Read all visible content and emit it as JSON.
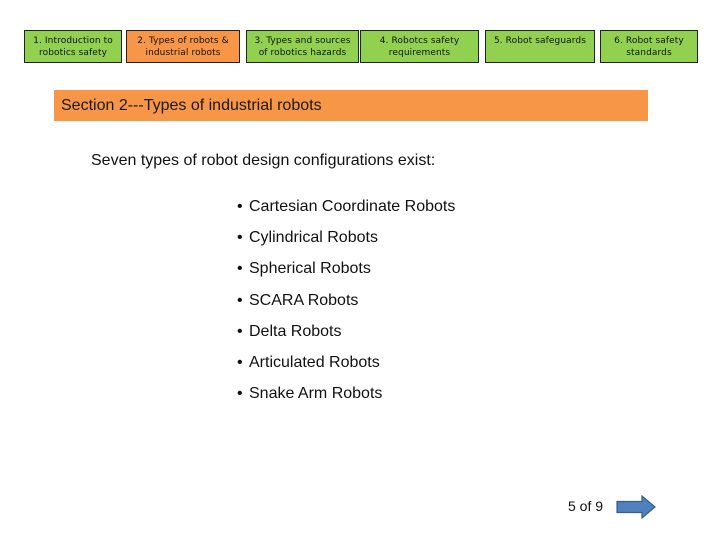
{
  "nav": {
    "items": [
      {
        "label": "1. Introduction to\nrobotics safety",
        "active": false
      },
      {
        "label": "2. Types of robots &\nindustrial robots",
        "active": true
      },
      {
        "label": "3. Types and sources\nof robotics hazards",
        "active": false
      },
      {
        "label": "4. Robotcs safety\nrequirements",
        "active": false
      },
      {
        "label": "5. Robot safeguards",
        "active": false
      },
      {
        "label": "6. Robot safety\nstandards",
        "active": false
      }
    ]
  },
  "section": {
    "title": "Section  2---Types of industrial robots"
  },
  "content": {
    "intro": "Seven types of robot design configurations exist:",
    "bullet_glyph": "•",
    "bullets": [
      "Cartesian Coordinate Robots",
      "Cylindrical Robots",
      "Spherical Robots",
      "SCARA Robots",
      "Delta Robots",
      "Articulated Robots",
      "Snake Arm Robots"
    ]
  },
  "pager": {
    "text": "5 of 9",
    "next_icon": "arrow-right-icon"
  },
  "colors": {
    "nav_inactive": "#92d050",
    "nav_active": "#f79646",
    "section_bar": "#f79646",
    "arrow_fill": "#4f81bd",
    "arrow_stroke": "#385d8a"
  }
}
